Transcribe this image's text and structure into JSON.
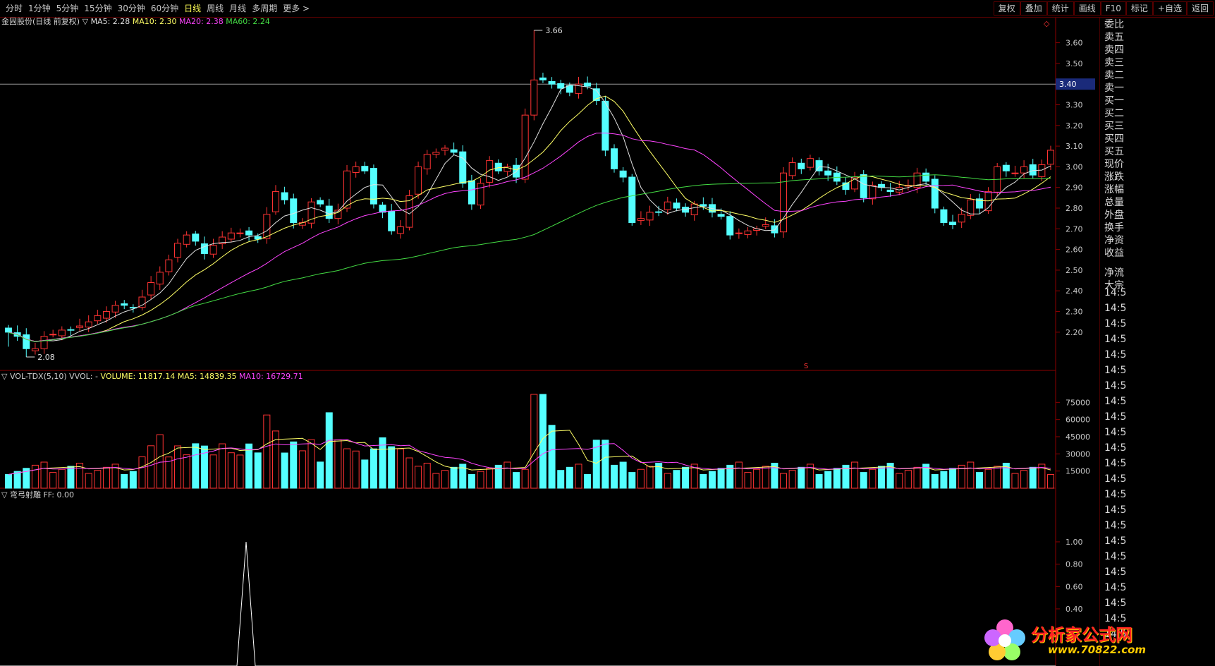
{
  "toolbar": {
    "periods": [
      "分时",
      "1分钟",
      "5分钟",
      "15分钟",
      "30分钟",
      "60分钟",
      "日线",
      "周线",
      "月线",
      "多周期",
      "更多 >"
    ],
    "active_period": "日线",
    "buttons": [
      "复权",
      "叠加",
      "统计",
      "画线",
      "F10",
      "标记",
      "+自选",
      "返回"
    ]
  },
  "main_panel": {
    "stock_title": "金固股份(日线 前复权)",
    "ma5_label": "MA5: 2.28",
    "ma10_label": "MA10: 2.30",
    "ma20_label": "MA20: 2.38",
    "ma60_label": "MA60: 2.24",
    "high_label": "3.66",
    "low_label": "2.08",
    "price_marker": "3.40",
    "y_ticks": [
      "3.60",
      "3.50",
      "3.40",
      "3.30",
      "3.20",
      "3.10",
      "3.00",
      "2.90",
      "2.80",
      "2.70",
      "2.60",
      "2.50",
      "2.40",
      "2.30",
      "2.20"
    ],
    "signal_mark": "S"
  },
  "volume_panel": {
    "title": "VOL-TDX(5,10)",
    "vvol": "VVOL: -",
    "volume_label": "VOLUME: 11817.14",
    "ma5_label": "MA5: 14839.35",
    "ma10_label": "MA10: 16729.71",
    "y_ticks": [
      "75000",
      "60000",
      "45000",
      "30000",
      "15000"
    ]
  },
  "indicator_panel": {
    "title": "弯弓射雕",
    "ff_label": "FF: 0.00",
    "y_ticks": [
      "1.00",
      "0.80",
      "0.60",
      "0.40"
    ]
  },
  "side_panel": {
    "labels": [
      "委比",
      "卖五",
      "卖四",
      "卖三",
      "卖二",
      "卖一",
      "买一",
      "买二",
      "买三",
      "买四",
      "买五",
      "现价",
      "涨跌",
      "涨幅",
      "总量",
      "外盘",
      "换手",
      "净资",
      "收益",
      "",
      "净流",
      "大宗"
    ],
    "time_rows": [
      "14:5",
      "14:5",
      "14:5",
      "14:5",
      "14:5",
      "14:5",
      "14:5",
      "14:5",
      "14:5",
      "14:5",
      "14:5",
      "14:5",
      "14:5",
      "14:5",
      "14:5",
      "14:5",
      "14:5",
      "14:5",
      "14:5",
      "14:5",
      "14:5",
      "14:5",
      "14:5"
    ]
  },
  "watermark": {
    "name": "分析家公式网",
    "url": "www.70822.com"
  },
  "colors": {
    "up": "#ff3333",
    "down": "#54ffff",
    "ma5": "#e0e0e0",
    "ma10": "#ffff66",
    "ma20": "#ff44ff",
    "ma60": "#44dd44",
    "border": "#8b0000",
    "axis_text": "#c8c8c8"
  },
  "chart_data": {
    "type": "candlestick",
    "closes": [
      2.2,
      2.18,
      2.12,
      2.12,
      2.18,
      2.19,
      2.21,
      2.21,
      2.23,
      2.25,
      2.28,
      2.3,
      2.33,
      2.33,
      2.32,
      2.37,
      2.44,
      2.49,
      2.55,
      2.63,
      2.67,
      2.64,
      2.58,
      2.62,
      2.66,
      2.68,
      2.68,
      2.67,
      2.65,
      2.77,
      2.88,
      2.84,
      2.73,
      2.73,
      2.83,
      2.82,
      2.75,
      2.79,
      2.98,
      3.0,
      2.98,
      2.82,
      2.78,
      2.69,
      2.71,
      2.86,
      3.0,
      3.06,
      3.07,
      3.09,
      3.07,
      2.92,
      2.82,
      2.92,
      3.03,
      2.98,
      3.0,
      2.95,
      3.25,
      3.42,
      3.42,
      3.4,
      3.38,
      3.36,
      3.4,
      3.39,
      3.32,
      3.08,
      2.99,
      2.95,
      2.73,
      2.75,
      2.78,
      2.78,
      2.83,
      2.8,
      2.78,
      2.82,
      2.81,
      2.78,
      2.76,
      2.67,
      2.68,
      2.69,
      2.7,
      2.72,
      2.68,
      2.97,
      3.02,
      2.99,
      3.04,
      2.98,
      2.96,
      2.93,
      2.89,
      2.95,
      2.85,
      2.91,
      2.9,
      2.88,
      2.9,
      2.91,
      2.97,
      2.93,
      2.8,
      2.73,
      2.72,
      2.77,
      2.84,
      2.8,
      2.88,
      3.0,
      2.98,
      2.97,
      3.0,
      2.96,
      3.01,
      3.08
    ]
  }
}
